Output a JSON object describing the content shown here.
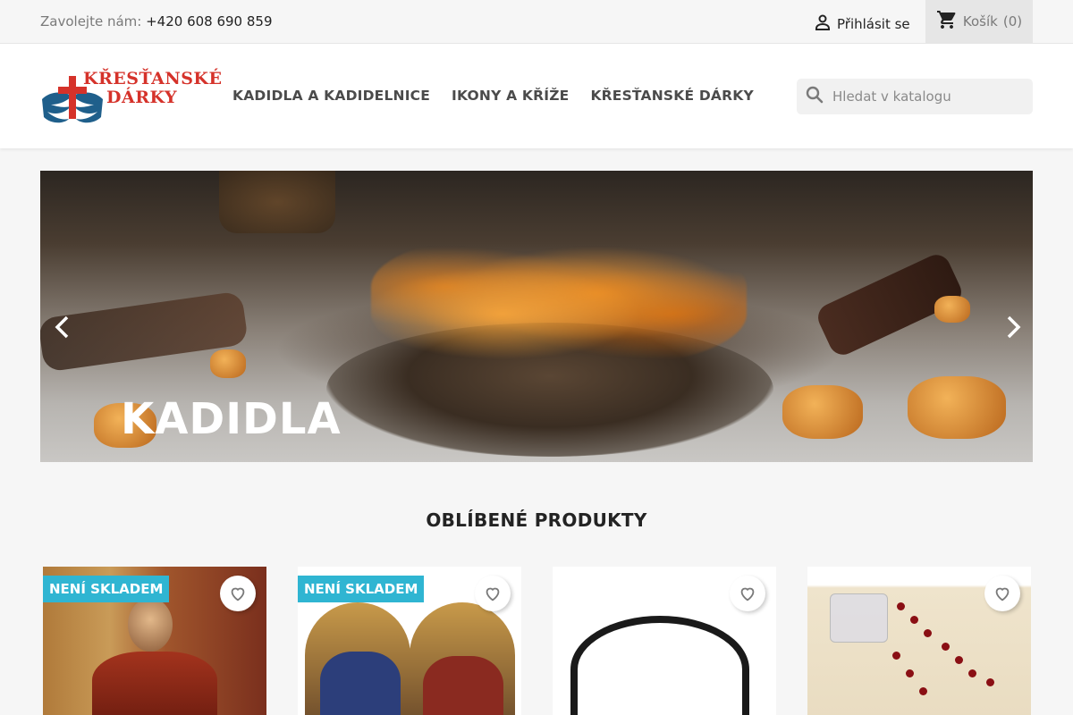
{
  "topbar": {
    "contact_label": "Zavolejte nám:",
    "phone": "+420 608 690 859",
    "signin_label": "Přihlásit se",
    "cart_label": "Košík",
    "cart_count": "(0)"
  },
  "header": {
    "logo_alt": "KŘESŤANSKÉ DÁRKY",
    "logo_line1": "KŘESŤANSKÉ",
    "logo_line2": "DÁRKY",
    "nav": [
      {
        "label": "KADIDLA A KADIDELNICE"
      },
      {
        "label": "IKONY A KŘÍŽE"
      },
      {
        "label": "KŘESŤANSKÉ DÁRKY"
      }
    ],
    "search_placeholder": "Hledat v katalogu"
  },
  "hero": {
    "title": "KADIDLA"
  },
  "section": {
    "title": "OBLÍBENÉ PRODUKTY"
  },
  "products": [
    {
      "badge": "NENÍ SKLADEM",
      "has_badge": true
    },
    {
      "badge": "NENÍ SKLADEM",
      "has_badge": true
    },
    {
      "badge": "",
      "has_badge": false
    },
    {
      "badge": "",
      "has_badge": false
    }
  ],
  "colors": {
    "accent": "#2fb5d2",
    "logo_red": "#d5322a",
    "logo_blue": "#1f5f8b"
  }
}
